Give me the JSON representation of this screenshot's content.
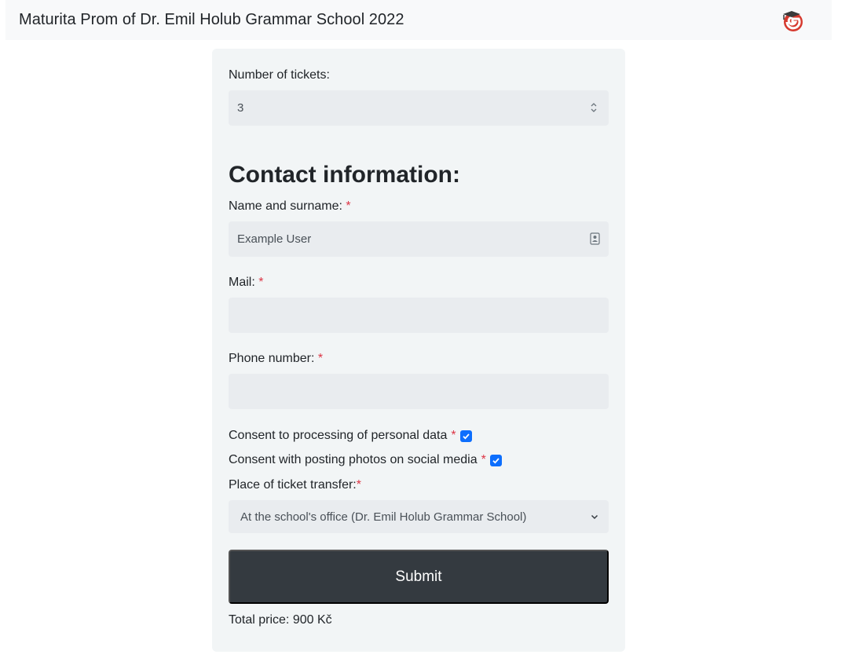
{
  "navbar": {
    "brand": "Maturita Prom of Dr. Emil Holub Grammar School 2022",
    "logo_icon": "school-logo-icon"
  },
  "form": {
    "tickets_label": "Number of tickets:",
    "tickets_value": "3",
    "contact_title": "Contact information:",
    "name_label": "Name and surname:",
    "name_value": "Example User",
    "mail_label": "Mail:",
    "mail_value": "",
    "phone_label": "Phone number:",
    "phone_value": "",
    "required_mark": "*",
    "consent_data_label": "Consent to processing of personal data",
    "consent_data_checked": true,
    "consent_photos_label": "Consent with posting photos on social media",
    "consent_photos_checked": true,
    "place_label": "Place of ticket transfer:",
    "place_value": "At the school's office (Dr. Emil Holub Grammar School)",
    "submit_label": "Submit",
    "total_price": "Total price: 900 Kč"
  },
  "colors": {
    "navbar_bg": "#f8f9fa",
    "card_bg": "#f2f5f6",
    "input_bg": "#e9ecef",
    "required": "#dc3545",
    "checkbox": "#0d6efd",
    "button_bg": "#343a40"
  }
}
